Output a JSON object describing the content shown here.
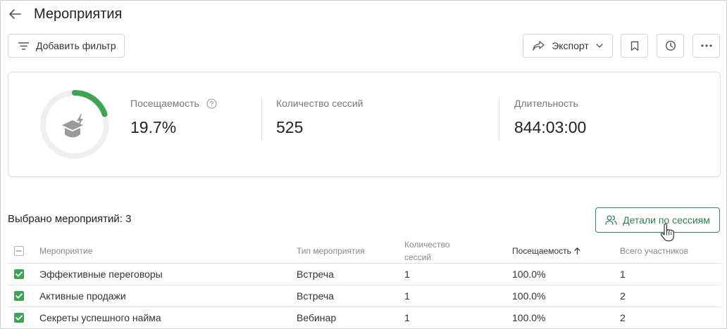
{
  "header": {
    "title": "Мероприятия",
    "back_icon": "arrow-left-icon"
  },
  "toolbar": {
    "add_filter_label": "Добавить фильтр",
    "export_label": "Экспорт",
    "icons": [
      "filter-icon",
      "share-icon",
      "chevron-down-icon",
      "bookmark-icon",
      "history-icon",
      "more-icon"
    ]
  },
  "stats": {
    "attendance_label": "Посещаемость",
    "attendance_value": "19.7%",
    "attendance_fraction": 0.197,
    "sessions_label": "Количество сессий",
    "sessions_value": "525",
    "duration_label": "Длительность",
    "duration_value": "844:03:00",
    "accent_color": "#3aa655",
    "track_color": "#efefef"
  },
  "selection": {
    "label": "Выбрано мероприятий: 3",
    "details_button_label": "Детали по сессиям",
    "button_color": "#2e8b57"
  },
  "table": {
    "columns": {
      "event": "Мероприятие",
      "type": "Тип мероприятия",
      "sessions_line1": "Количество",
      "sessions_line2": "сессий",
      "attendance": "Посещаемость",
      "participants": "Всего участников"
    },
    "sort_column": "attendance",
    "rows": [
      {
        "checked": true,
        "event": "Эффективные переговоры",
        "type": "Встреча",
        "sessions": "1",
        "attendance": "100.0%",
        "participants": "1"
      },
      {
        "checked": true,
        "event": "Активные продажи",
        "type": "Встреча",
        "sessions": "1",
        "attendance": "100.0%",
        "participants": "2"
      },
      {
        "checked": true,
        "event": "Секреты успешного найма",
        "type": "Вебинар",
        "sessions": "1",
        "attendance": "100.0%",
        "participants": "2"
      }
    ]
  }
}
